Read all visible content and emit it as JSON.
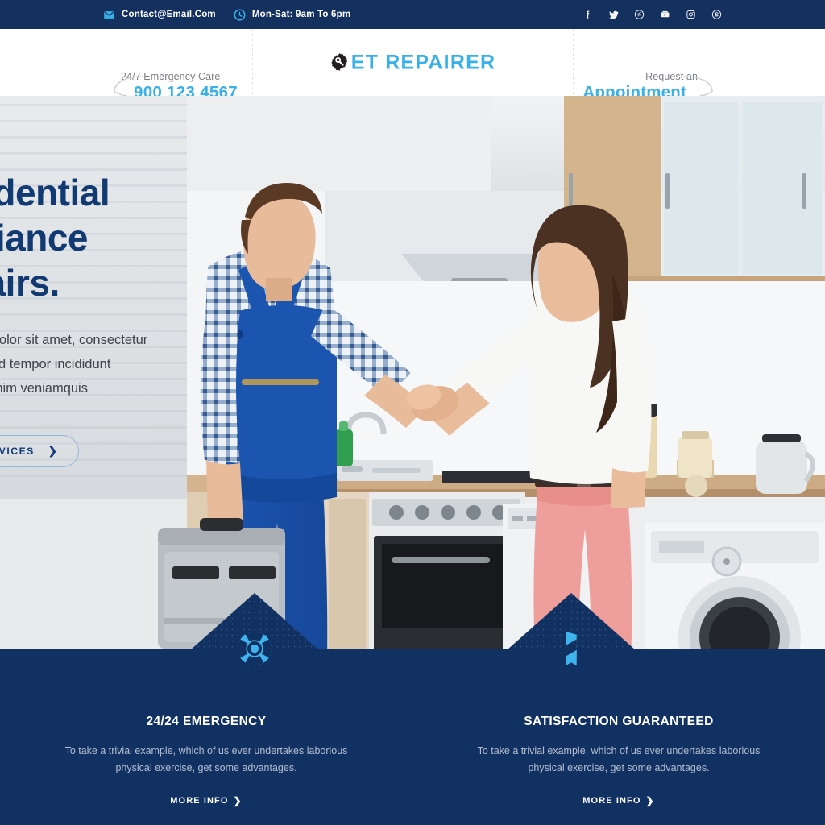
{
  "topbar": {
    "email": "Contact@Email.Com",
    "hours": "Mon-Sat: 9am To 6pm",
    "email_icon": "envelope-icon",
    "clock_icon": "clock-icon",
    "social": [
      {
        "name": "facebook-icon",
        "label": "Facebook"
      },
      {
        "name": "twitter-icon",
        "label": "Twitter"
      },
      {
        "name": "pinterest-icon",
        "label": "Pinterest"
      },
      {
        "name": "youtube-icon",
        "label": "YouTube"
      },
      {
        "name": "instagram-icon",
        "label": "Instagram"
      },
      {
        "name": "skype-icon",
        "label": "Skype"
      }
    ],
    "background": "#14305f"
  },
  "header": {
    "emergency_label": "24/7 Emergency Care",
    "phone": "900 123 4567",
    "logo_text": "ET REPAIRER",
    "logo_icon": "gear-wrench-icon",
    "appointment_label": "Request an",
    "appointment_link": "Appointment",
    "accent": "#38b0e8"
  },
  "hero": {
    "title_line1": "sidential",
    "title_line2": "pliance",
    "title_line3": "pairs.",
    "sub_line1": "sum dolor sit amet, consectetur",
    "sub_line2": "iusmod tempor incididunt",
    "sub_line3": "ad minim veniamquis",
    "button_label": "E SERVICES",
    "button_chevron": "❯",
    "title_color": "#113a73"
  },
  "features": [
    {
      "icon": "lifebuoy-icon",
      "title": "24/24 EMERGENCY",
      "text": "To take a trivial example, which of us ever undertakes laborious physical exercise, get some advantages.",
      "more_label": "MORE INFO",
      "more_chevron": "❯"
    },
    {
      "icon": "houzz-icon",
      "title": "SATISFACTION GUARANTEED",
      "text": "To take a trivial example, which of us ever undertakes laborious physical exercise, get some advantages.",
      "more_label": "MORE INFO",
      "more_chevron": "❯"
    }
  ],
  "colors": {
    "band": "#123163",
    "accent_light": "#38b0e8",
    "navy": "#113a73"
  }
}
